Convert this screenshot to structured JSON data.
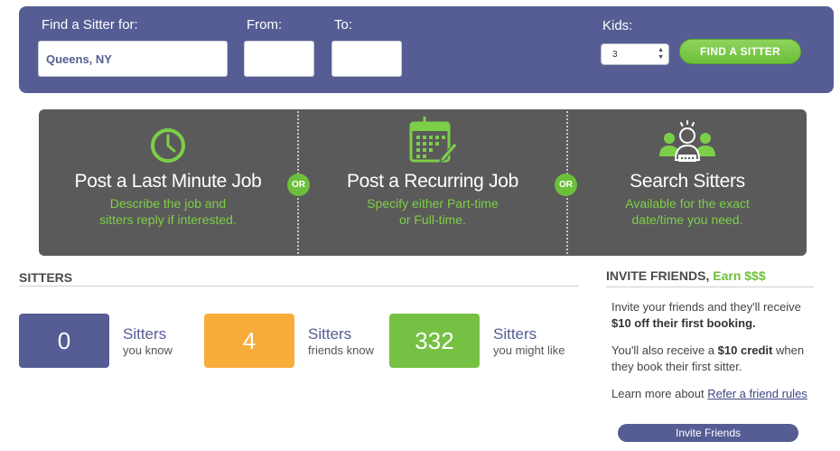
{
  "search": {
    "find_label": "Find a Sitter for:",
    "location_value": "Queens, NY",
    "from_label": "From:",
    "from_value": "",
    "to_label": "To:",
    "to_value": "",
    "kids_label": "Kids:",
    "kids_value": "3",
    "find_button": "FIND A SITTER"
  },
  "options": [
    {
      "title": "Post a Last Minute Job",
      "desc_line1": "Describe the job and",
      "desc_line2": "sitters reply if interested.",
      "icon": "clock-icon"
    },
    {
      "title": "Post a Recurring Job",
      "desc_line1": "Specify either Part-time",
      "desc_line2": "or Full-time.",
      "icon": "calendar-pencil-icon"
    },
    {
      "title": "Search Sitters",
      "desc_line1": "Available for the exact",
      "desc_line2": "date/time you need.",
      "icon": "rated-sitters-icon"
    }
  ],
  "or_label": "OR",
  "sitters": {
    "title": "SITTERS",
    "stats": [
      {
        "count": "0",
        "label": "Sitters",
        "sublabel": "you know",
        "color": "#555d94"
      },
      {
        "count": "4",
        "label": "Sitters",
        "sublabel": "friends know",
        "color": "#f8ad3a"
      },
      {
        "count": "332",
        "label": "Sitters",
        "sublabel": "you might like",
        "color": "#76c043"
      }
    ]
  },
  "invite": {
    "title": "INVITE FRIENDS,",
    "earn": "Earn $$$",
    "p1_text": "Invite your friends and they'll receive",
    "p1_bold": "$10 off their first booking.",
    "p2_text1": "You'll also receive a",
    "p2_bold": "$10 credit",
    "p2_text2": "when they book their first sitter.",
    "p3_text": "Learn more about",
    "p3_link": "Refer a friend rules",
    "button": "Invite Friends"
  },
  "colors": {
    "brand_purple": "#555d94",
    "accent_green": "#76c043",
    "panel_gray": "#5a5a5a",
    "orange": "#f8ad3a"
  }
}
